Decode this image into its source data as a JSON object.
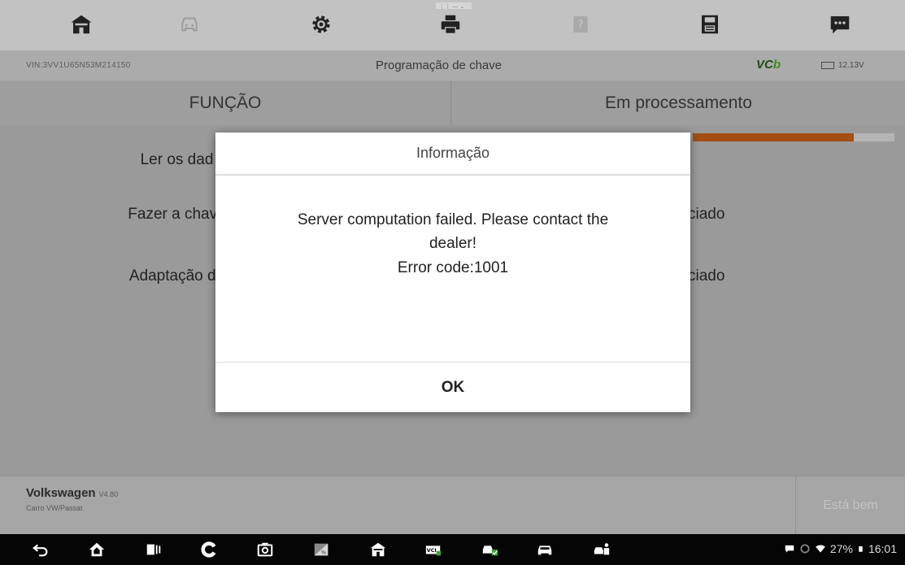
{
  "toolbar": {
    "icons": [
      "home-icon",
      "vehicle-icon",
      "settings-icon",
      "print-icon",
      "help-icon",
      "save-icon",
      "message-icon"
    ]
  },
  "infobar": {
    "vin": "VIN:3VV1U65N53M214150",
    "title": "Programação de chave",
    "vci_prefix": "VC",
    "vci_suffix": "b",
    "voltage": "12.13V"
  },
  "table": {
    "headers": [
      "FUNÇÃO",
      "Em processamento"
    ],
    "rows": [
      {
        "function": "Ler os dad",
        "status": ""
      },
      {
        "function": "Fazer a chave",
        "status": "ciado"
      },
      {
        "function": "Adaptação da",
        "status": "ciado"
      }
    ],
    "progress_fraction": 0.8
  },
  "dialog": {
    "title": "Informação",
    "line1": "Server computation failed. Please contact the",
    "line2": "dealer!",
    "line3": "Error code:1001",
    "button": "OK"
  },
  "bottom": {
    "brand": "Volkswagen",
    "version": "V4.80",
    "path": "Carro VW/Passat",
    "action": "Está bem"
  },
  "statusbar": {
    "battery": "27%",
    "time": "16:01"
  },
  "colors": {
    "progress": "#a24e14",
    "vci_green": "#3f8f1f"
  }
}
